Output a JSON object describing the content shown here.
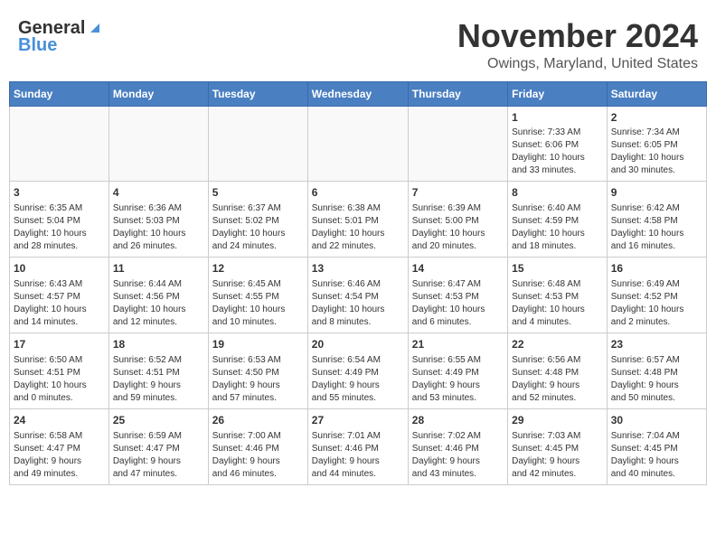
{
  "header": {
    "logo_line1": "General",
    "logo_line2": "Blue",
    "month": "November 2024",
    "location": "Owings, Maryland, United States"
  },
  "weekdays": [
    "Sunday",
    "Monday",
    "Tuesday",
    "Wednesday",
    "Thursday",
    "Friday",
    "Saturday"
  ],
  "weeks": [
    [
      {
        "day": "",
        "info": ""
      },
      {
        "day": "",
        "info": ""
      },
      {
        "day": "",
        "info": ""
      },
      {
        "day": "",
        "info": ""
      },
      {
        "day": "",
        "info": ""
      },
      {
        "day": "1",
        "info": "Sunrise: 7:33 AM\nSunset: 6:06 PM\nDaylight: 10 hours\nand 33 minutes."
      },
      {
        "day": "2",
        "info": "Sunrise: 7:34 AM\nSunset: 6:05 PM\nDaylight: 10 hours\nand 30 minutes."
      }
    ],
    [
      {
        "day": "3",
        "info": "Sunrise: 6:35 AM\nSunset: 5:04 PM\nDaylight: 10 hours\nand 28 minutes."
      },
      {
        "day": "4",
        "info": "Sunrise: 6:36 AM\nSunset: 5:03 PM\nDaylight: 10 hours\nand 26 minutes."
      },
      {
        "day": "5",
        "info": "Sunrise: 6:37 AM\nSunset: 5:02 PM\nDaylight: 10 hours\nand 24 minutes."
      },
      {
        "day": "6",
        "info": "Sunrise: 6:38 AM\nSunset: 5:01 PM\nDaylight: 10 hours\nand 22 minutes."
      },
      {
        "day": "7",
        "info": "Sunrise: 6:39 AM\nSunset: 5:00 PM\nDaylight: 10 hours\nand 20 minutes."
      },
      {
        "day": "8",
        "info": "Sunrise: 6:40 AM\nSunset: 4:59 PM\nDaylight: 10 hours\nand 18 minutes."
      },
      {
        "day": "9",
        "info": "Sunrise: 6:42 AM\nSunset: 4:58 PM\nDaylight: 10 hours\nand 16 minutes."
      }
    ],
    [
      {
        "day": "10",
        "info": "Sunrise: 6:43 AM\nSunset: 4:57 PM\nDaylight: 10 hours\nand 14 minutes."
      },
      {
        "day": "11",
        "info": "Sunrise: 6:44 AM\nSunset: 4:56 PM\nDaylight: 10 hours\nand 12 minutes."
      },
      {
        "day": "12",
        "info": "Sunrise: 6:45 AM\nSunset: 4:55 PM\nDaylight: 10 hours\nand 10 minutes."
      },
      {
        "day": "13",
        "info": "Sunrise: 6:46 AM\nSunset: 4:54 PM\nDaylight: 10 hours\nand 8 minutes."
      },
      {
        "day": "14",
        "info": "Sunrise: 6:47 AM\nSunset: 4:53 PM\nDaylight: 10 hours\nand 6 minutes."
      },
      {
        "day": "15",
        "info": "Sunrise: 6:48 AM\nSunset: 4:53 PM\nDaylight: 10 hours\nand 4 minutes."
      },
      {
        "day": "16",
        "info": "Sunrise: 6:49 AM\nSunset: 4:52 PM\nDaylight: 10 hours\nand 2 minutes."
      }
    ],
    [
      {
        "day": "17",
        "info": "Sunrise: 6:50 AM\nSunset: 4:51 PM\nDaylight: 10 hours\nand 0 minutes."
      },
      {
        "day": "18",
        "info": "Sunrise: 6:52 AM\nSunset: 4:51 PM\nDaylight: 9 hours\nand 59 minutes."
      },
      {
        "day": "19",
        "info": "Sunrise: 6:53 AM\nSunset: 4:50 PM\nDaylight: 9 hours\nand 57 minutes."
      },
      {
        "day": "20",
        "info": "Sunrise: 6:54 AM\nSunset: 4:49 PM\nDaylight: 9 hours\nand 55 minutes."
      },
      {
        "day": "21",
        "info": "Sunrise: 6:55 AM\nSunset: 4:49 PM\nDaylight: 9 hours\nand 53 minutes."
      },
      {
        "day": "22",
        "info": "Sunrise: 6:56 AM\nSunset: 4:48 PM\nDaylight: 9 hours\nand 52 minutes."
      },
      {
        "day": "23",
        "info": "Sunrise: 6:57 AM\nSunset: 4:48 PM\nDaylight: 9 hours\nand 50 minutes."
      }
    ],
    [
      {
        "day": "24",
        "info": "Sunrise: 6:58 AM\nSunset: 4:47 PM\nDaylight: 9 hours\nand 49 minutes."
      },
      {
        "day": "25",
        "info": "Sunrise: 6:59 AM\nSunset: 4:47 PM\nDaylight: 9 hours\nand 47 minutes."
      },
      {
        "day": "26",
        "info": "Sunrise: 7:00 AM\nSunset: 4:46 PM\nDaylight: 9 hours\nand 46 minutes."
      },
      {
        "day": "27",
        "info": "Sunrise: 7:01 AM\nSunset: 4:46 PM\nDaylight: 9 hours\nand 44 minutes."
      },
      {
        "day": "28",
        "info": "Sunrise: 7:02 AM\nSunset: 4:46 PM\nDaylight: 9 hours\nand 43 minutes."
      },
      {
        "day": "29",
        "info": "Sunrise: 7:03 AM\nSunset: 4:45 PM\nDaylight: 9 hours\nand 42 minutes."
      },
      {
        "day": "30",
        "info": "Sunrise: 7:04 AM\nSunset: 4:45 PM\nDaylight: 9 hours\nand 40 minutes."
      }
    ]
  ]
}
